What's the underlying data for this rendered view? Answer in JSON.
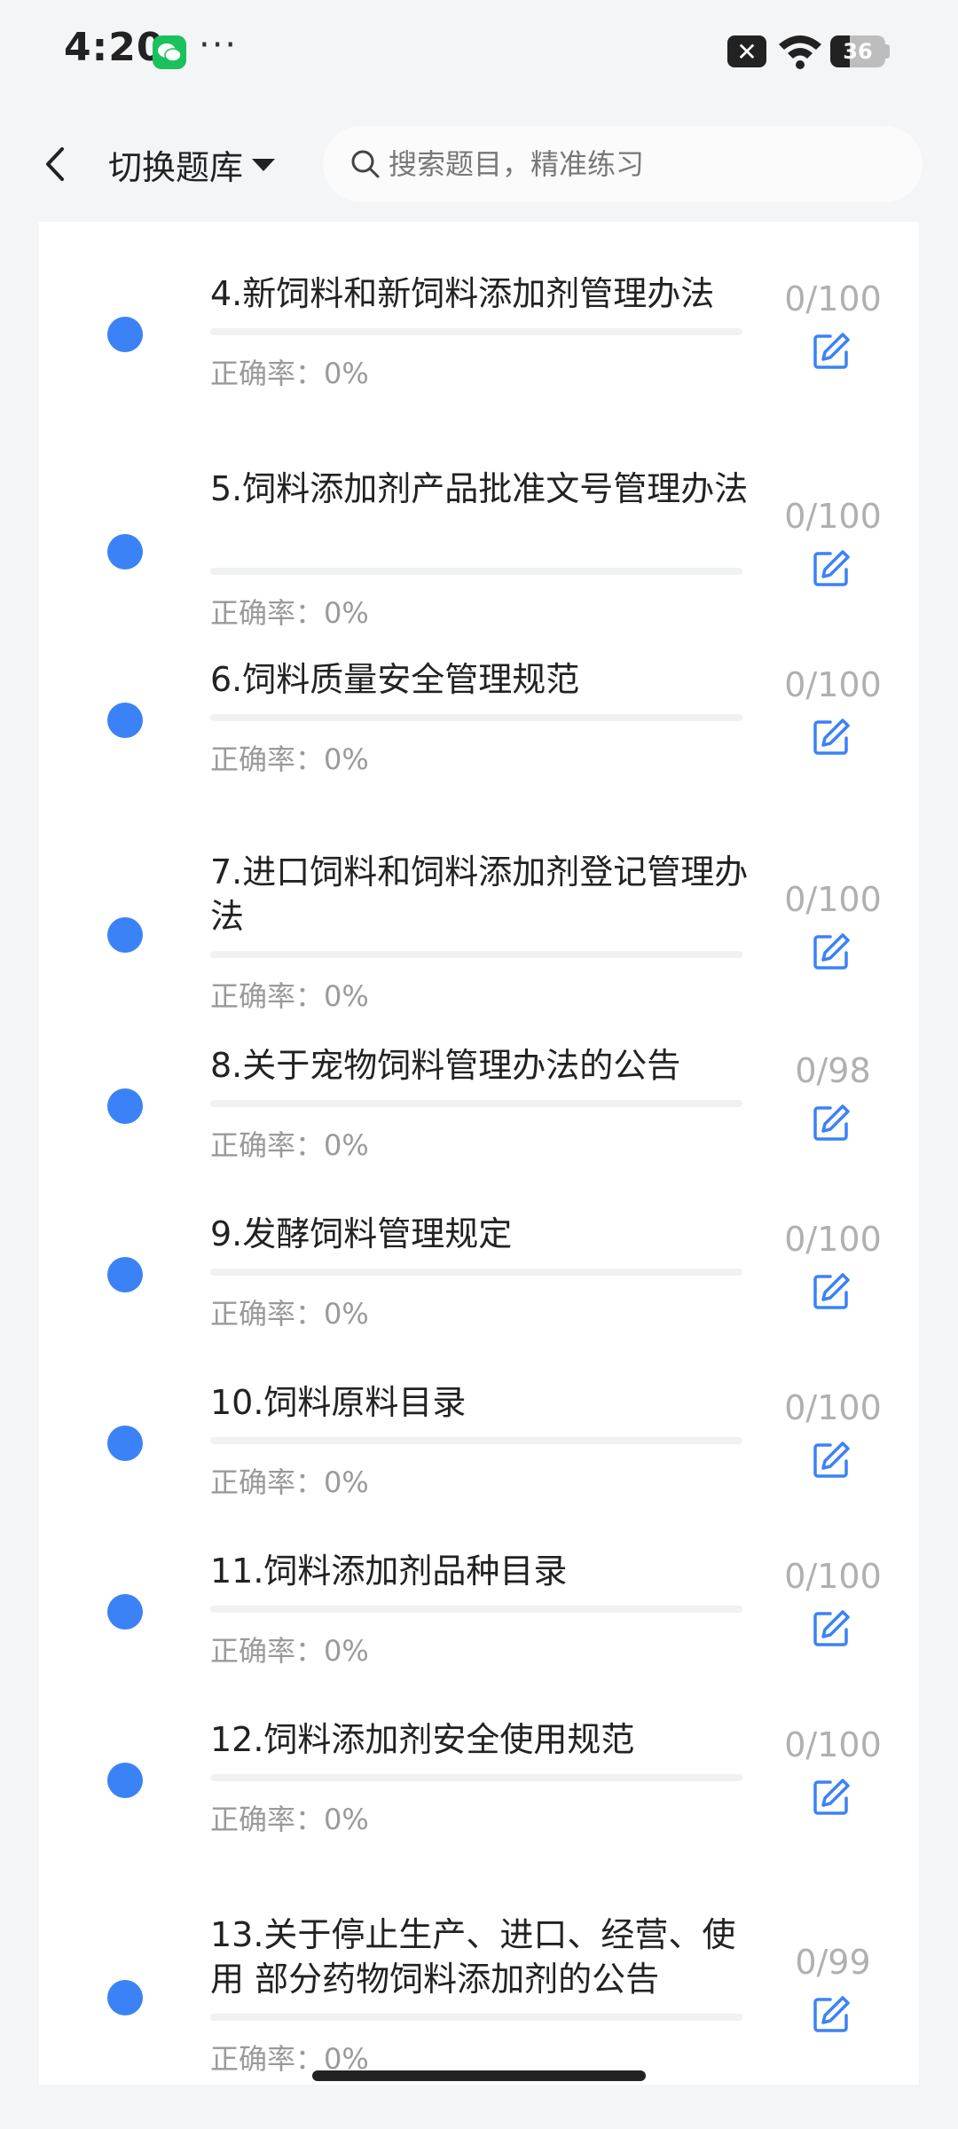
{
  "status": {
    "time": "4:20",
    "dots": "···",
    "close_glyph": "✕",
    "battery": "36",
    "battery_level": 0.36
  },
  "header": {
    "switch_label": "切换题库",
    "search_placeholder": "搜索题目，精准练习"
  },
  "colors": {
    "accent": "#3b82f6",
    "muted": "#9a9a9a",
    "count": "#b0b0b0"
  },
  "items": [
    {
      "title": "4.新饲料和新饲料添加剂管理办法",
      "accuracy": "正确率：0%",
      "count": "0/100",
      "progress": 0
    },
    {
      "title": "5.饲料添加剂产品批准文号管理办法",
      "accuracy": "正确率：0%",
      "count": "0/100",
      "progress": 0
    },
    {
      "title": "6.饲料质量安全管理规范",
      "accuracy": "正确率：0%",
      "count": "0/100",
      "progress": 0
    },
    {
      "title": "7.进口饲料和饲料添加剂登记管理办 法",
      "accuracy": "正确率：0%",
      "count": "0/100",
      "progress": 0
    },
    {
      "title": "8.关于宠物饲料管理办法的公告",
      "accuracy": "正确率：0%",
      "count": "0/98",
      "progress": 0
    },
    {
      "title": "9.发酵饲料管理规定",
      "accuracy": "正确率：0%",
      "count": "0/100",
      "progress": 0
    },
    {
      "title": "10.饲料原料目录",
      "accuracy": "正确率：0%",
      "count": "0/100",
      "progress": 0
    },
    {
      "title": "11.饲料添加剂品种目录",
      "accuracy": "正确率：0%",
      "count": "0/100",
      "progress": 0
    },
    {
      "title": "12.饲料添加剂安全使用规范",
      "accuracy": "正确率：0%",
      "count": "0/100",
      "progress": 0
    },
    {
      "title": "13.关于停止生产、进口、经营、使用 部分药物饲料添加剂的公告",
      "accuracy": "正确率：0%",
      "count": "0/99",
      "progress": 0
    }
  ]
}
